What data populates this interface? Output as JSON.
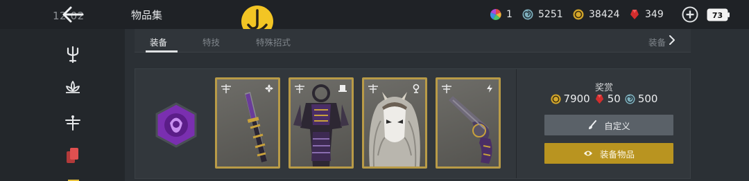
{
  "topbar": {
    "clock": "12:02",
    "title": "物品集",
    "currencies": [
      {
        "icon": "multicolor-wheel-icon",
        "value": "1"
      },
      {
        "icon": "blue-swirl-icon",
        "value": "5251"
      },
      {
        "icon": "gold-coin-icon",
        "value": "38424"
      },
      {
        "icon": "red-gem-icon",
        "value": "349"
      }
    ],
    "battery": "73"
  },
  "tabs": {
    "items": [
      "装备",
      "特技",
      "特殊招式"
    ],
    "active_index": 0,
    "more_label": "装备"
  },
  "cards": [
    {
      "name": "katana",
      "tag": "diamond-cross-icon"
    },
    {
      "name": "samurai-armor",
      "tag": "top-hat-icon"
    },
    {
      "name": "lion-mask",
      "tag": "pin-icon"
    },
    {
      "name": "revolver",
      "tag": "lightning-icon"
    }
  ],
  "reward": {
    "title": "奖赏",
    "gold": "7900",
    "gem": "50",
    "swirl": "500"
  },
  "buttons": {
    "customize": "自定义",
    "equip": "装备物品"
  },
  "colors": {
    "accent_gold": "#b99420",
    "card_border": "#b99b47",
    "emblem_purple": "#7a2fb0",
    "gem_red": "#d32d2d"
  }
}
